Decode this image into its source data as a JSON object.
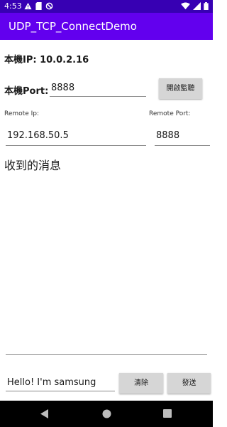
{
  "status_bar": {
    "time": "4:53",
    "left_icons": [
      "alert-icon",
      "sim-card-icon",
      "sync-icon"
    ],
    "right_icons": [
      "wifi-icon",
      "signal-icon",
      "battery-icon"
    ]
  },
  "app_bar": {
    "title": "UDP_TCP_ConnectDemo",
    "color": "#6200ee",
    "status_color": "#3700b3"
  },
  "local": {
    "ip_text": "本機IP: 10.0.2.16",
    "port_label": "本機Port:",
    "port_value": "8888",
    "listen_button": "開啟監聽"
  },
  "remote": {
    "ip_label": "Remote Ip:",
    "ip_value": "192.168.50.5",
    "port_label": "Remote Port:",
    "port_value": "8888"
  },
  "received": {
    "heading": "收到的消息",
    "content": ""
  },
  "compose": {
    "message_value": "Hello! I'm samsung",
    "clear_button": "清除",
    "send_button": "發送"
  },
  "nav": {
    "icons": [
      "back-icon",
      "home-icon",
      "recents-icon"
    ]
  }
}
